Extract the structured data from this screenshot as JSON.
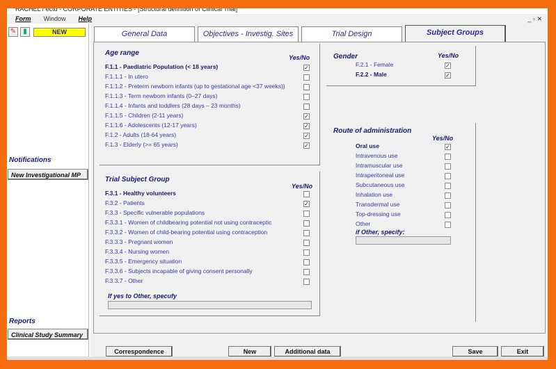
{
  "window": {
    "title": "RACHEL / ectd - CORPORATE ENTITIES - [Structural definition of Clinical Trial]",
    "controls": "_  ▫  ✕"
  },
  "menu": {
    "form": "Form",
    "window": "Window",
    "help": "Help"
  },
  "sidebar": {
    "new_badge": "NEW",
    "notifications_heading": "Notifications",
    "notifications_button": "New Investigational MP",
    "reports_heading": "Reports",
    "reports_button": "Clinical Study Summary"
  },
  "tabs": [
    "General Data",
    "Objectives -  Investig. Sites",
    "Trial Design",
    "Subject Groups"
  ],
  "age_range": {
    "title": "Age range",
    "yesno": "Yes/No",
    "items": [
      {
        "label": "F.1.1 - Paediatric Population (< 18 years)",
        "bold": true,
        "checked": true
      },
      {
        "label": "F.1.1.1 - In utero",
        "checked": false
      },
      {
        "label": "F.1.1.2 - Preterm newborn infants (up to gestational age <37 weeks))",
        "checked": false
      },
      {
        "label": "F.1.1.3 - Term newborn infants (0–27 days)",
        "checked": false
      },
      {
        "label": "F.1.1.4 - Infants and toddlers (28 days – 23 months)",
        "checked": false
      },
      {
        "label": "F.1.1.5 - Children (2-11 years)",
        "checked": true
      },
      {
        "label": "F.1.1.6 - Adolescents (12-17 years)",
        "checked": true
      },
      {
        "label": "F.1.2 - Adults (18-64 years)",
        "checked": true
      },
      {
        "label": "F.1.3 - Elderly (>= 65 years)",
        "checked": true
      }
    ]
  },
  "subject_group": {
    "title": "Trial Subject Group",
    "yesno": "Yes/No",
    "other_label": "If yes to Other, specufy",
    "other_value": "",
    "items": [
      {
        "label": "F.3.1 - Healthy volunteers",
        "bold": true,
        "checked": false
      },
      {
        "label": "F.3.2 - Patients",
        "checked": true
      },
      {
        "label": "F.3.3 - Specific vulnerable populations",
        "checked": false
      },
      {
        "label": "F.3.3.1 - Women of childbearing potential not using contraceptic",
        "checked": false
      },
      {
        "label": "F.3.3.2 - Women of child-bearing potential using contraception",
        "checked": false
      },
      {
        "label": "F.3.3.3 - Pregnant women",
        "checked": false
      },
      {
        "label": "F.3.3.4 - Nursing women",
        "checked": false
      },
      {
        "label": "F.3.3.5 - Emergency situation",
        "checked": false
      },
      {
        "label": "F.3.3.6 - Subjects incapable of giving consent personally",
        "checked": false
      },
      {
        "label": "F.3.3.7 - Other",
        "checked": false
      }
    ]
  },
  "gender": {
    "title": "Gender",
    "yesno": "Yes/No",
    "items": [
      {
        "label": "F.2.1 - Female",
        "checked": true
      },
      {
        "label": "F.2.2 - Male",
        "bold": true,
        "checked": true
      }
    ]
  },
  "route": {
    "title": "Route of administration",
    "yesno": "Yes/No",
    "other_label": "if Other, specify:",
    "other_value": "",
    "items": [
      {
        "label": "Oral use",
        "bold": true,
        "checked": true
      },
      {
        "label": "Intravenous use",
        "checked": false
      },
      {
        "label": "Intramuscular use",
        "checked": false
      },
      {
        "label": "Intraperitoneal use",
        "checked": false
      },
      {
        "label": "Subcutaneous use",
        "checked": false
      },
      {
        "label": "Inhalation use",
        "checked": false
      },
      {
        "label": "Transdermal use",
        "checked": false
      },
      {
        "label": "Top-dressing use",
        "checked": false
      },
      {
        "label": "Other",
        "checked": false
      }
    ]
  },
  "buttons": {
    "correspondence": "Correspondence",
    "new": "New",
    "additional": "Additional data",
    "save": "Save",
    "exit": "Exit"
  }
}
